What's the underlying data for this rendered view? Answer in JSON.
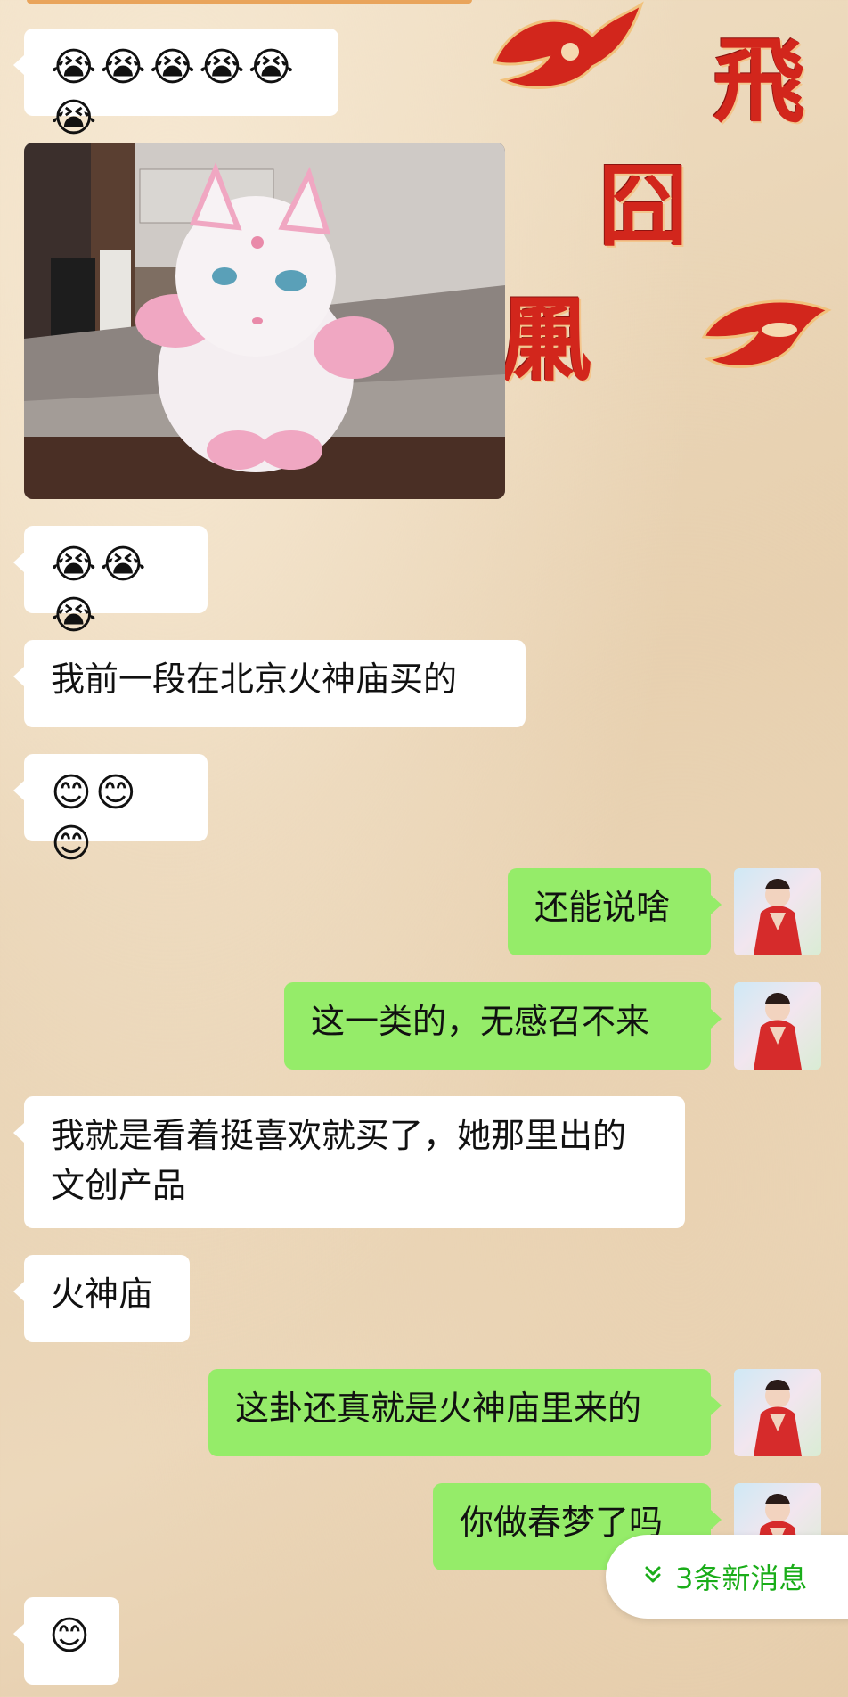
{
  "background": {
    "decor_chars": [
      "飛",
      "囧",
      "凲"
    ],
    "accent_color": "#d2261c"
  },
  "messages": [
    {
      "side": "left",
      "type": "emoji",
      "emoji": "😭😭😭😭😭😭"
    },
    {
      "side": "left",
      "type": "image",
      "description_icon": "plush-cat-photo"
    },
    {
      "side": "left",
      "type": "emoji",
      "emoji": "😭😭😭"
    },
    {
      "side": "left",
      "type": "text",
      "text": "我前一段在北京火神庙买的"
    },
    {
      "side": "left",
      "type": "emoji",
      "emoji": "😊😊😊"
    },
    {
      "side": "right",
      "type": "text",
      "text": "还能说啥"
    },
    {
      "side": "right",
      "type": "text",
      "text": "这一类的，无感召不来"
    },
    {
      "side": "left",
      "type": "text",
      "text": "我就是看着挺喜欢就买了，她那里出的文创产品"
    },
    {
      "side": "left",
      "type": "text",
      "text": "火神庙"
    },
    {
      "side": "right",
      "type": "text",
      "text": "这卦还真就是火神庙里来的"
    },
    {
      "side": "right",
      "type": "text",
      "text": "你做春梦了吗"
    },
    {
      "side": "left",
      "type": "emoji",
      "emoji": "😊"
    }
  ],
  "new_messages": {
    "icon": "double-chevron-down-icon",
    "label": "3条新消息"
  },
  "colors": {
    "left_bubble": "#ffffff",
    "right_bubble": "#95ec69",
    "new_msg_text": "#1aad19"
  }
}
